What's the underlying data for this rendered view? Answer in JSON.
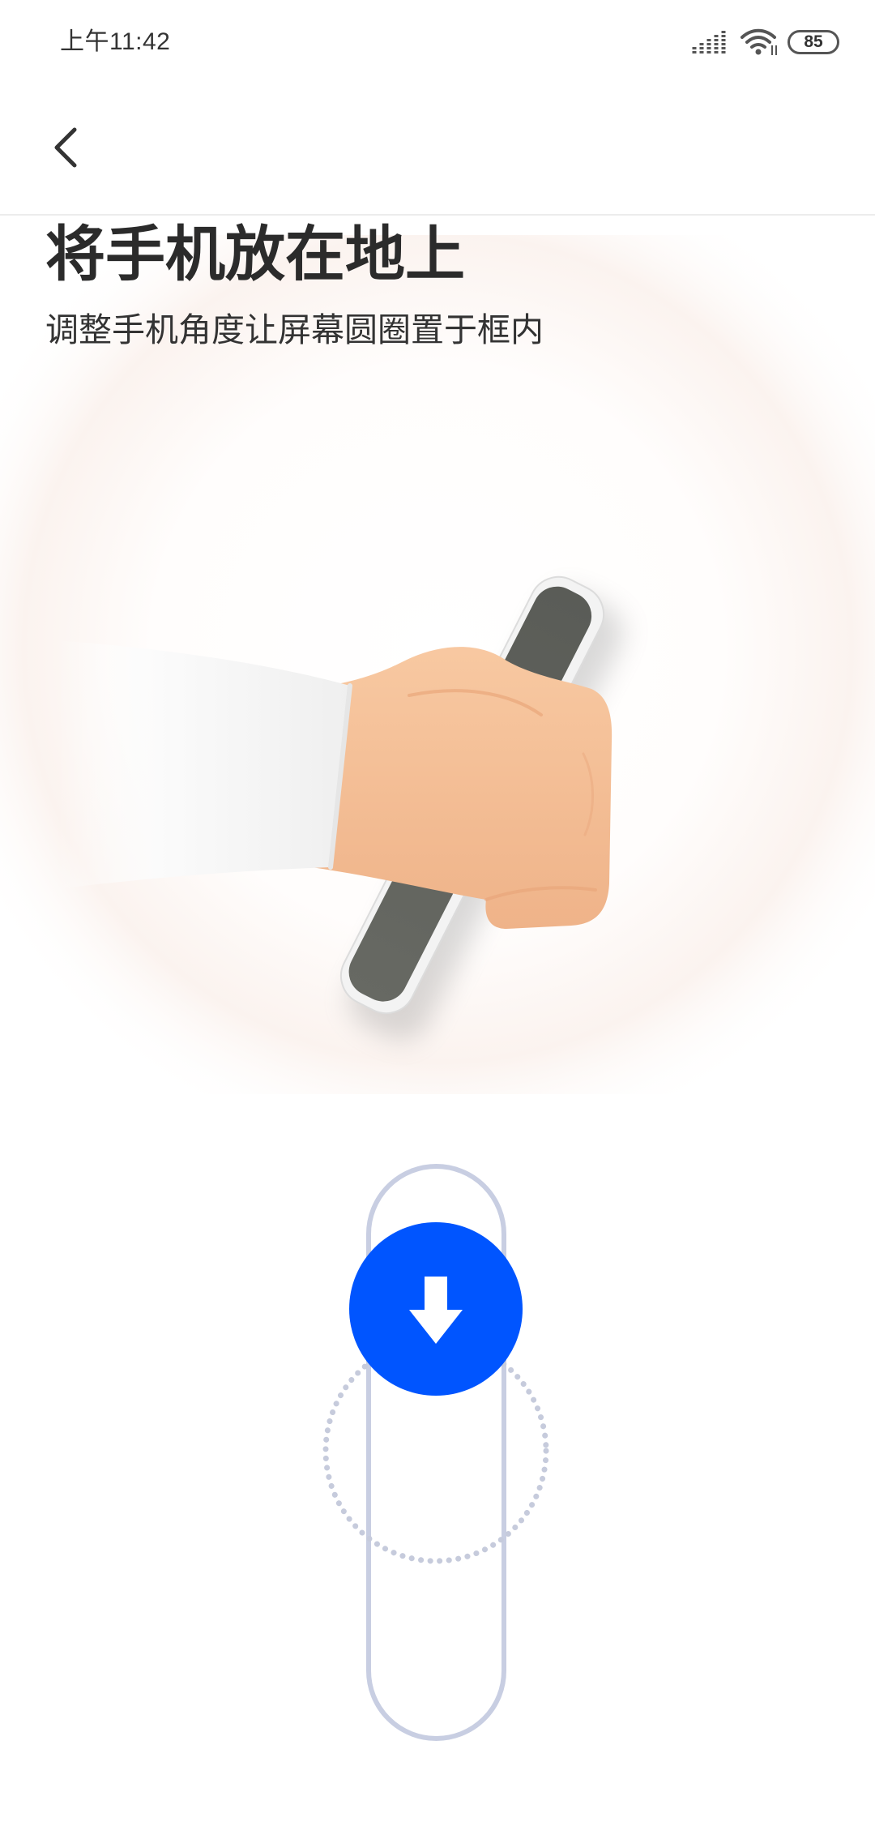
{
  "status_bar": {
    "time": "上午11:42",
    "battery_level": "85",
    "signal_icon": "signal-icon",
    "wifi_icon": "wifi-icon",
    "battery_icon": "battery-icon"
  },
  "header": {
    "back_icon": "chevron-left-icon"
  },
  "content": {
    "title": "将手机放在地上",
    "subtitle": "调整手机角度让屏幕圆圈置于框内"
  },
  "calibration": {
    "target_icon": "arrow-down-icon",
    "accent_color": "#0055FF",
    "track_color": "#C8CEE2",
    "guide_color": "#C6CBDC"
  },
  "colors": {
    "text_primary": "#333333",
    "divider": "#ECECEC",
    "background": "#FFFFFF"
  }
}
